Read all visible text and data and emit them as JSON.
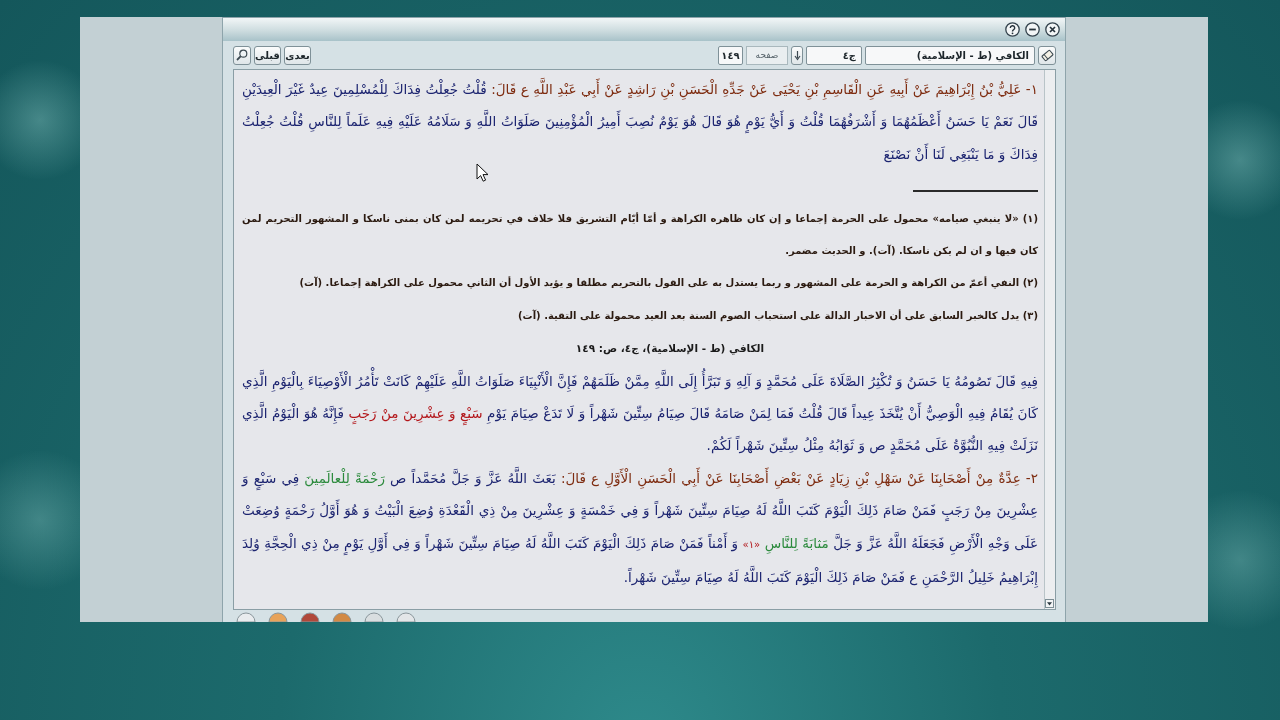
{
  "toolbar": {
    "book_title": "الكافي (ط - الإسلامية)",
    "volume": "ج٤",
    "page_label": "صفحه",
    "page": "١٤٩",
    "nav_buttons": [
      "بعدى",
      "قبلى"
    ]
  },
  "previous_page": {
    "paragraphs": [
      {
        "segments": [
          {
            "kind": "isnad",
            "text": "١- عَلِيُّ بْنُ إِبْرَاهِيمَ عَنْ أَبِيهِ عَنِ الْقَاسِمِ بْنِ يَحْيَى عَنْ جَدِّهِ الْحَسَنِ بْنِ رَاشِدٍ عَنْ أَبِي عَبْدِ اللَّهِ ع قَالَ:"
          },
          {
            "kind": "matn",
            "text": "قُلْتُ جُعِلْتُ فِدَاكَ لِلْمُسْلِمِينَ عِيدٌ غَيْرَ الْعِيدَيْنِ قَالَ نَعَمْ يَا حَسَنُ أَعْظَمُهُمَا وَ أَشْرَفُهُمَا قُلْتُ وَ أَيُّ يَوْمٍ هُوَ قَالَ هُوَ يَوْمٌ نُصِبَ أَمِيرُ الْمُؤْمِنِينَ صَلَوَاتُ اللَّهِ وَ سَلَامُهُ عَلَيْهِ فِيهِ عَلَماً لِلنَّاسِ قُلْتُ جُعِلْتُ فِدَاكَ وَ مَا يَنْبَغِي لَنَا أَنْ نَصْنَعَ"
          }
        ]
      }
    ],
    "footnotes": [
      "(١) «لا ينبغي صيامه» محمول على الحرمة إجماعا و إن كان ظاهره الكراهة و أمّا أيّام التشريق فلا خلاف في تحريمه لمن كان بمنى ناسكا و المشهور التحريم لمن كان فيها و ان لم يكن ناسكا. (آت). و الحديث مضمر.",
      "(٢) النفي أعمّ من الكراهة و الحرمة على المشهور و ربما يستدل به على القول بالتحريم مطلقا و يؤيد الأول أن الثاني محمول على الكراهة إجماعا. (آت)",
      "(٣) يدل كالخبر السابق على أن الاخبار الدالة على استحباب الصوم السنة بعد العيد محمولة على التقية. (آت)"
    ]
  },
  "current_page": {
    "header": "الكافي (ط - الإسلامية)، ج٤، ص: ١٤٩",
    "paragraphs": [
      {
        "segments": [
          {
            "kind": "matn",
            "text": "فِيهِ قَالَ تَصُومُهُ يَا حَسَنُ وَ تُكْثِرُ الصَّلَاةَ عَلَى مُحَمَّدٍ وَ آلِهِ وَ تَبَرَّأُ إِلَى اللَّهِ مِمَّنْ ظَلَمَهُمْ فَإِنَّ الْأَنْبِيَاءَ صَلَوَاتُ اللَّهِ عَلَيْهِمْ كَانَتْ تَأْمُرُ الْأَوْصِيَاءَ بِالْيَوْمِ الَّذِي كَانَ يُقَامُ فِيهِ الْوَصِيُّ أَنْ يُتَّخَذَ عِيداً قَالَ قُلْتُ فَمَا لِمَنْ صَامَهُ قَالَ صِيَامُ سِتِّينَ شَهْراً وَ لَا تَدَعْ صِيَامَ يَوْمِ"
          },
          {
            "kind": "date",
            "text": "سَبْعٍ وَ عِشْرِينَ مِنْ رَجَبٍ"
          },
          {
            "kind": "matn",
            "text": "فَإِنَّهُ هُوَ الْيَوْمُ الَّذِي نَزَلَتْ فِيهِ النُّبُوَّةُ عَلَى مُحَمَّدٍ ص وَ ثَوَابُهُ مِثْلُ سِتِّينَ شَهْراً لَكُمْ."
          }
        ]
      },
      {
        "segments": [
          {
            "kind": "isnad",
            "text": "٢- عِدَّةٌ مِنْ أَصْحَابِنَا عَنْ سَهْلِ بْنِ زِيَادٍ عَنْ بَعْضِ أَصْحَابِنَا عَنْ أَبِي الْحَسَنِ الْأَوَّلِ ع قَالَ:"
          },
          {
            "kind": "matn",
            "text": "بَعَثَ اللَّهُ عَزَّ وَ جَلَّ مُحَمَّداً ص"
          },
          {
            "kind": "quran",
            "text": "رَحْمَةً لِلْعالَمِينَ"
          },
          {
            "kind": "matn",
            "text": "فِي سَبْعٍ وَ عِشْرِينَ مِنْ رَجَبٍ فَمَنْ صَامَ ذَلِكَ الْيَوْمَ كَتَبَ اللَّهُ لَهُ صِيَامَ سِتِّينَ شَهْراً وَ فِي خَمْسَةٍ وَ عِشْرِينَ مِنْ ذِي الْقَعْدَةِ وُضِعَ الْبَيْتُ وَ هُوَ أَوَّلُ رَحْمَةٍ وُضِعَتْ عَلَى وَجْهِ الْأَرْضِ فَجَعَلَهُ اللَّهُ عَزَّ وَ جَلَّ"
          },
          {
            "kind": "quran",
            "text": "مَثابَةً لِلنَّاسِ"
          },
          {
            "kind": "ref",
            "text": "«١»"
          },
          {
            "kind": "matn",
            "text": "وَ أَمْناً فَمَنْ صَامَ ذَلِكَ الْيَوْمَ كَتَبَ اللَّهُ لَهُ صِيَامَ سِتِّينَ شَهْراً وَ فِي أَوَّلِ يَوْمٍ مِنْ ذِي الْحِجَّةِ وُلِدَ إِبْرَاهِيمُ خَلِيلُ الرَّحْمَنِ ع فَمَنْ صَامَ ذَلِكَ الْيَوْمَ كَتَبَ اللَّهُ لَهُ صِيَامَ سِتِّينَ شَهْراً."
          }
        ]
      }
    ]
  }
}
